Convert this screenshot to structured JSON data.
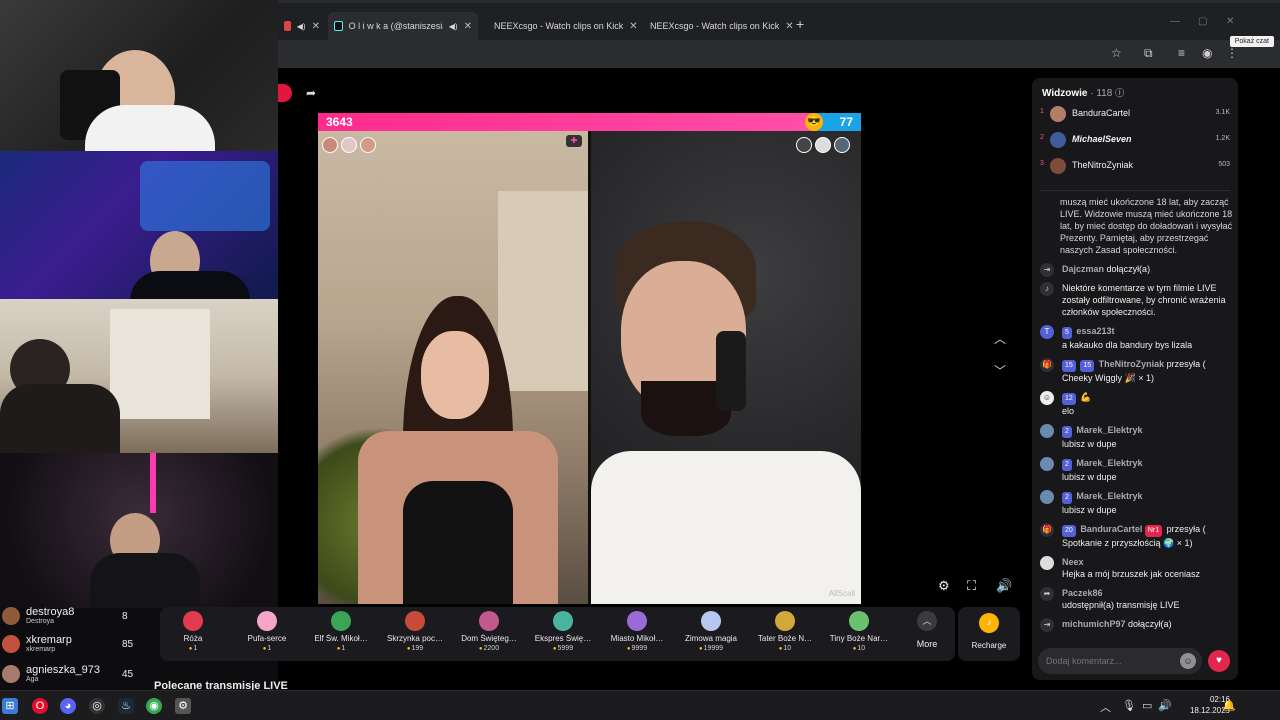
{
  "browser": {
    "tabs": [
      {
        "title": "",
        "favicon": "#d44",
        "has_audio": true
      },
      {
        "title": "O l i w k a (@staniszesia_) p",
        "favicon": "#111",
        "has_audio": true
      },
      {
        "title": "NEEXcsgo - Watch clips on Kick",
        "favicon": "#53fc18"
      },
      {
        "title": "NEEXcsgo - Watch clips on Kick",
        "favicon": "#53fc18"
      }
    ],
    "new_tab": "+",
    "tooltip": "Pokaż czat"
  },
  "battle": {
    "score_left": "3643",
    "score_right": "77",
    "watermark": "AllScall"
  },
  "gifts": [
    {
      "name": "Róża",
      "cost": "1",
      "color": "#e23a4e"
    },
    {
      "name": "Pufa-serce",
      "cost": "1",
      "color": "#f3a6c6"
    },
    {
      "name": "Elf Św. Mikoł…",
      "cost": "1",
      "color": "#3aa457"
    },
    {
      "name": "Skrzynka poc…",
      "cost": "199",
      "color": "#c84b3a"
    },
    {
      "name": "Dom Święteg…",
      "cost": "2200",
      "color": "#c05a8e"
    },
    {
      "name": "Ekspres Świę…",
      "cost": "5999",
      "color": "#4bb4a0"
    },
    {
      "name": "Miasto Mikoł…",
      "cost": "9999",
      "color": "#9c6ad6"
    },
    {
      "name": "Zimowa magia",
      "cost": "19999",
      "color": "#b7c7ef"
    },
    {
      "name": "Tater Boże N…",
      "cost": "10",
      "color": "#d2a73b"
    },
    {
      "name": "Tiny Boże Nar…",
      "cost": "10",
      "color": "#6cc26c"
    }
  ],
  "more_label": "More",
  "recharge_label": "Recharge",
  "leaderboard": [
    {
      "name": "destroya8",
      "sub": "Destroya",
      "value": "8",
      "color": "#8e5a3b"
    },
    {
      "name": "xkremarp",
      "sub": "xkremarp",
      "value": "85",
      "color": "#c1533e"
    },
    {
      "name": "agnieszka_973",
      "sub": "Aga",
      "value": "45",
      "color": "#a87a6c"
    }
  ],
  "recommended": "Polecane transmisje LIVE",
  "viewers": {
    "title": "Widzowie",
    "count": "· 118",
    "top": [
      {
        "rank": "1",
        "name": "BanduraCartel",
        "points": "3.1K",
        "color": "#b37d6a"
      },
      {
        "rank": "2",
        "name": "MichaelSeven",
        "points": "1.2K",
        "color": "#3e5c9a"
      },
      {
        "rank": "3",
        "name": "TheNitroZyniak",
        "points": "503",
        "color": "#7c4d3a"
      }
    ]
  },
  "chat": {
    "system_notice": "muszą mieć ukończone 18 lat, aby zacząć LIVE. Widzowie muszą mieć ukończone 18 lat, by mieć dostęp do doładowań i wysyłać Prezenty. Pamiętaj, aby przestrzegać naszych Zasad społeczności.",
    "m1_user": "Dajczman",
    "m1_text": "dołączył(a)",
    "m2_text": "Niektóre komentarze w tym filmie LIVE zostały odfiltrowane, by chronić wrażenia członków społeczności.",
    "m3_badge": "5",
    "m3_user": "essa213t",
    "m3_text": "a kakauko dla bandury bys lizala",
    "m4_badge1": "15",
    "m4_badge2": "15",
    "m4_user": "TheNitroZyniak",
    "m4_text": "przesyła ( Cheeky Wiggly 🎉 × 1)",
    "m5_badge": "12",
    "m5_text": "elo",
    "m6_badge": "2",
    "m6_user": "Marek_Elektryk",
    "m6_text": "lubisz w dupe",
    "m7_badge": "2",
    "m7_user": "Marek_Elektryk",
    "m7_text": "lubisz w dupe",
    "m8_badge": "2",
    "m8_user": "Marek_Elektryk",
    "m8_text": "lubisz w dupe",
    "m9_badge": "20",
    "m9_user": "BanduraCartel",
    "m9_badge2": "Nr1",
    "m9_text": "przesyła ( Spotkanie z przyszłością 🌍 × 1)",
    "m10_user": "Neex",
    "m10_text": "Hejka a mój brzuszek jak oceniasz",
    "m11_user": "Paczek86",
    "m11_text": "udostępnił(a) transmisję LIVE",
    "m12_user": "michumichP97",
    "m12_text": "dołączył(a)",
    "input_placeholder": "Dodaj komentarz..."
  },
  "taskbar": {
    "time": "02:16",
    "date": "18.12.2025"
  }
}
